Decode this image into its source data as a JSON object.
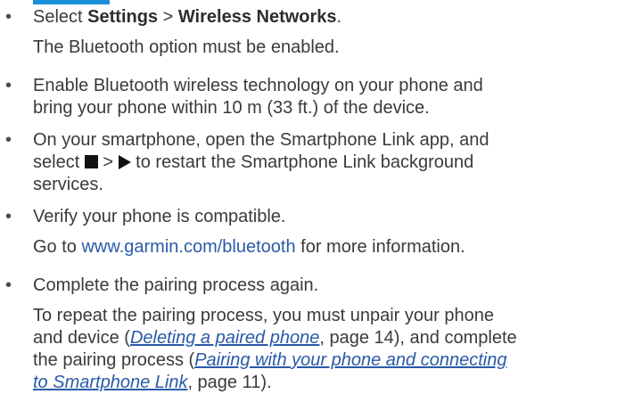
{
  "bullet_char": "•",
  "items": [
    {
      "prefix": "Select ",
      "bold1": "Settings",
      "mid": " > ",
      "bold2": "Wireless Networks",
      "suffix": ".",
      "sub": "The Bluetooth option must be enabled."
    },
    {
      "line1": "Enable Bluetooth wireless technology on your phone and",
      "line2": "bring your phone within 10 m (33 ft.) of the device."
    },
    {
      "line1": "On your smartphone, open the Smartphone Link app, and",
      "line2_prefix": "select ",
      "line2_mid": " > ",
      "line2_suffix": " to restart the Smartphone Link background",
      "line3": "services.",
      "icon1": "stop-square-icon",
      "icon2": "play-triangle-icon"
    },
    {
      "line1": "Verify your phone is compatible.",
      "sub_prefix": "Go to ",
      "sub_link": "www.garmin.com/bluetooth",
      "sub_suffix": " for more information."
    },
    {
      "line1": "Complete the pairing process again.",
      "sub1": "To repeat the pairing process, you must unpair your phone",
      "sub2_prefix": "and device (",
      "sub2_xref": "Deleting a paired phone",
      "sub2_suffix": ", page 14), and complete",
      "sub3_prefix": "the pairing process (",
      "sub3_xref": "Pairing with your phone and connecting",
      "sub4_xref": "to Smartphone Link",
      "sub4_suffix": ", page 11)."
    }
  ],
  "colors": {
    "text": "#3a3a3a",
    "link": "#2a5aa8",
    "accent_rule": "#1a8fd8"
  }
}
